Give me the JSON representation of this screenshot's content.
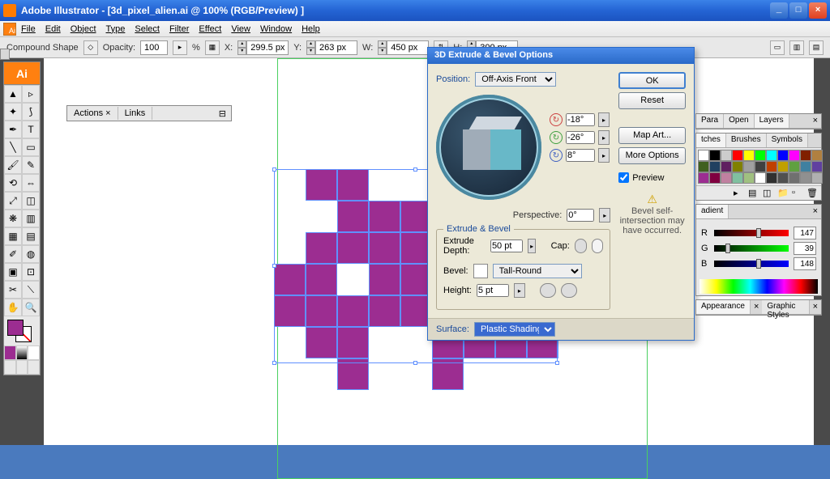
{
  "titlebar": {
    "title": "Adobe Illustrator - [3d_pixel_alien.ai @ 100% (RGB/Preview) ]"
  },
  "menu": {
    "items": [
      "File",
      "Edit",
      "Object",
      "Type",
      "Select",
      "Filter",
      "Effect",
      "View",
      "Window",
      "Help"
    ]
  },
  "controlbar": {
    "shape_label": "Compound Shape",
    "opacity_label": "Opacity:",
    "opacity_value": "100",
    "opacity_unit": "%",
    "x_label": "X:",
    "x_value": "299.5 px",
    "y_label": "Y:",
    "y_value": "263 px",
    "w_label": "W:",
    "w_value": "450 px",
    "h_label": "H:",
    "h_value": "300 px"
  },
  "actions_panel": {
    "tab1": "Actions",
    "tab2": "Links"
  },
  "dialog": {
    "title": "3D Extrude & Bevel Options",
    "position_label": "Position:",
    "position_value": "Off-Axis Front",
    "rot_x": "-18°",
    "rot_y": "-26°",
    "rot_z": "8°",
    "perspective_label": "Perspective:",
    "perspective_value": "0°",
    "group_eb": "Extrude & Bevel",
    "extrude_depth_label": "Extrude Depth:",
    "extrude_depth_value": "50 pt",
    "cap_label": "Cap:",
    "bevel_label": "Bevel:",
    "bevel_value": "Tall-Round",
    "height_label": "Height:",
    "height_value": "5 pt",
    "surface_label": "Surface:",
    "surface_value": "Plastic Shading",
    "btn_ok": "OK",
    "btn_reset": "Reset",
    "btn_map": "Map Art...",
    "btn_more": "More Options",
    "preview_label": "Preview",
    "warning": "Bevel self-intersection may have occurred."
  },
  "rpanels": {
    "layers_tabs": [
      "Para",
      "Open",
      "Layers"
    ],
    "swatch_tabs": [
      "tches",
      "Brushes",
      "Symbols"
    ],
    "gradient_tab": "adient",
    "rgb": {
      "r": "147",
      "g": "39",
      "b": "148"
    },
    "appearance_tab": "Appearance",
    "graphic_tab": "Graphic Styles"
  },
  "swatch_colors": [
    "#ffffff",
    "#000000",
    "#cccccc",
    "#ff0000",
    "#ffff00",
    "#00ff00",
    "#00ffff",
    "#0000ff",
    "#ff00ff",
    "#802000",
    "#b08040",
    "#406020",
    "#204060",
    "#602060",
    "#808000",
    "#a0a0a0",
    "#404040",
    "#c04000",
    "#c0a000",
    "#60a040",
    "#4080a0",
    "#6040a0",
    "#9c2d91",
    "#800040",
    "#c080a0",
    "#80c0a0",
    "#a0c080",
    "#ffffff",
    "#303030",
    "#505050",
    "#707070",
    "#909090",
    "#b0b0b0"
  ]
}
